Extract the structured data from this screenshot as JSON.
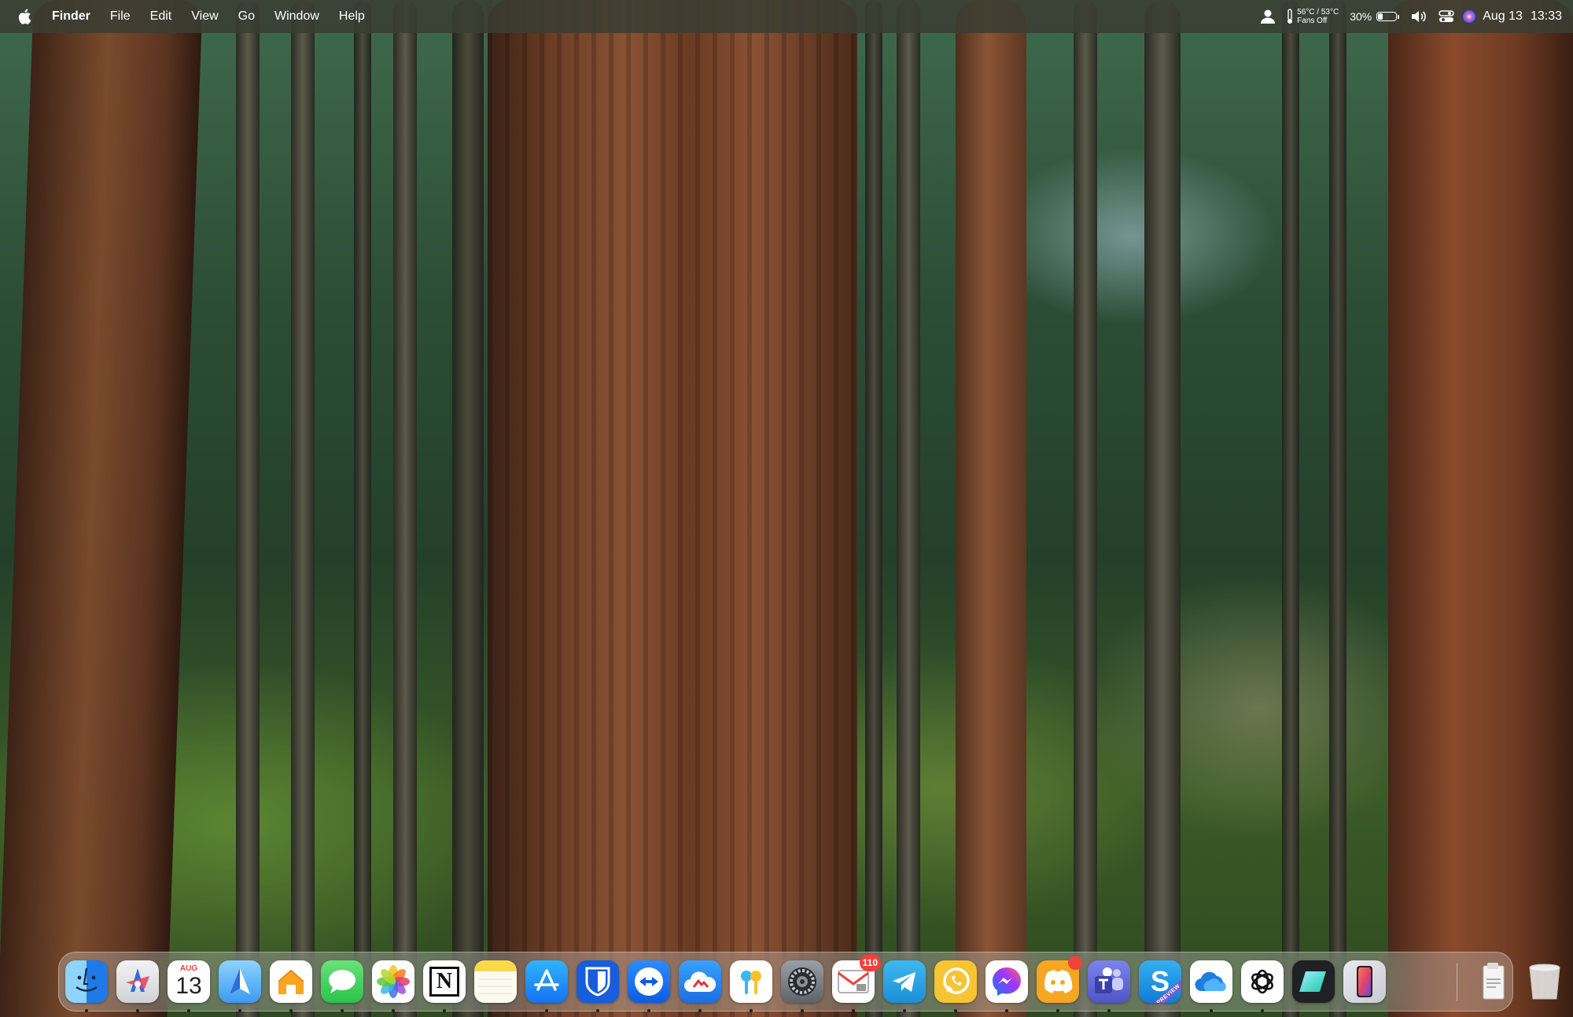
{
  "menubar": {
    "app_name": "Finder",
    "menus": [
      "File",
      "Edit",
      "View",
      "Go",
      "Window",
      "Help"
    ],
    "temp_line1": "56°C / 53°C",
    "temp_line2": "Fans Off",
    "battery_percent_text": "30%",
    "battery_level": 0.3,
    "date": "Aug 13",
    "time": "13:33"
  },
  "dock": {
    "apps": [
      {
        "name": "Finder",
        "icon": "finder-icon"
      },
      {
        "name": "Launchpad",
        "icon": "launchpad-icon"
      },
      {
        "name": "Calendar",
        "icon": "calendar-icon",
        "month": "AUG",
        "day": "13"
      },
      {
        "name": "Maps",
        "icon": "maps-icon"
      },
      {
        "name": "Home",
        "icon": "home-icon"
      },
      {
        "name": "Messages",
        "icon": "messages-icon"
      },
      {
        "name": "Photos",
        "icon": "photos-icon"
      },
      {
        "name": "Notion",
        "icon": "notion-icon",
        "glyph": "N"
      },
      {
        "name": "Notes",
        "icon": "notes-icon"
      },
      {
        "name": "App Store",
        "icon": "app-store-icon"
      },
      {
        "name": "Bitwarden",
        "icon": "bitwarden-icon"
      },
      {
        "name": "TeamViewer",
        "icon": "teamviewer-icon"
      },
      {
        "name": "Creative Cloud",
        "icon": "creative-cloud-icon"
      },
      {
        "name": "Passwords",
        "icon": "passwords-icon"
      },
      {
        "name": "System Settings",
        "icon": "system-settings-icon"
      },
      {
        "name": "Mail",
        "icon": "mail-icon",
        "badge": "110"
      },
      {
        "name": "Telegram",
        "icon": "telegram-icon"
      },
      {
        "name": "WhatsApp",
        "icon": "whatsapp-icon"
      },
      {
        "name": "Messenger",
        "icon": "messenger-icon"
      },
      {
        "name": "Discord",
        "icon": "discord-icon"
      },
      {
        "name": "Microsoft Teams",
        "icon": "teams-icon"
      },
      {
        "name": "Skype Preview",
        "icon": "skype-icon",
        "glyph": "S",
        "ribbon": "PREVIEW"
      },
      {
        "name": "OneDrive",
        "icon": "onedrive-icon"
      },
      {
        "name": "ChatGPT",
        "icon": "chatgpt-icon"
      },
      {
        "name": "Linear",
        "icon": "linear-icon"
      },
      {
        "name": "iPhone Mirroring",
        "icon": "iphone-mirroring-icon"
      }
    ],
    "right": [
      {
        "name": "Downloads",
        "icon": "downloads-stack-icon"
      },
      {
        "name": "Trash",
        "icon": "trash-icon"
      }
    ]
  }
}
